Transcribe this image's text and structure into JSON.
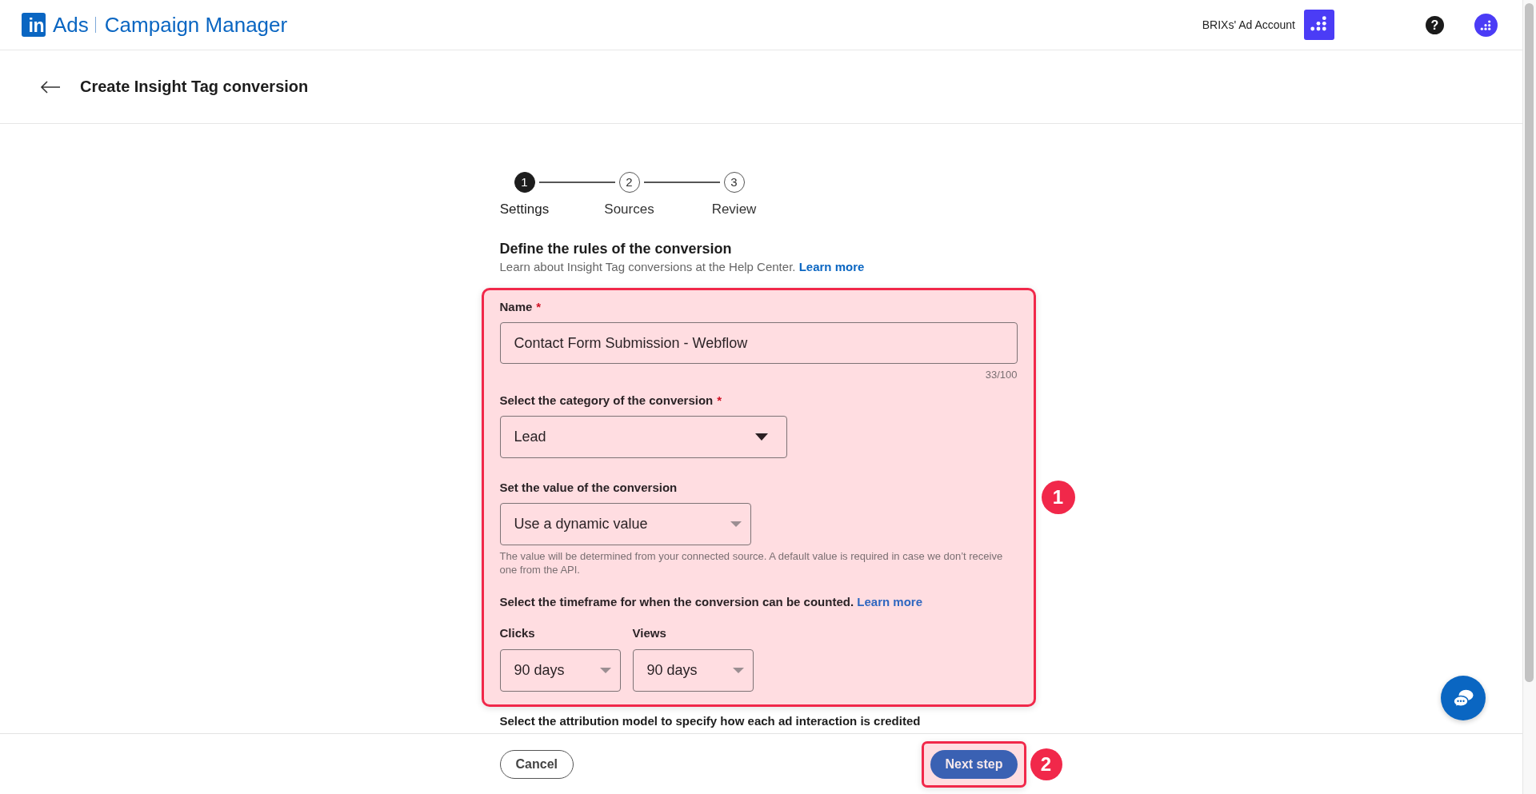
{
  "top_bar": {
    "logo": {
      "mark": "in",
      "product": "Ads",
      "app": "Campaign Manager"
    },
    "account": {
      "name": "BRIXs' Ad Account"
    },
    "help": "?"
  },
  "page_header": {
    "title": "Create Insight Tag conversion"
  },
  "stepper": {
    "steps": [
      {
        "number": "1",
        "label": "Settings",
        "selected": true
      },
      {
        "number": "2",
        "label": "Sources",
        "selected": false
      },
      {
        "number": "3",
        "label": "Review",
        "selected": false
      }
    ]
  },
  "section": {
    "title": "Define the rules of the conversion",
    "description": "Learn about Insight Tag conversions at the Help Center.",
    "link": "Learn more"
  },
  "form": {
    "annotation": {
      "number": "1"
    },
    "fields": [
      {
        "kind": "text",
        "label": "Name",
        "required_mark": "*",
        "value": "Contact Form Submission - Webflow",
        "counter": "33/100"
      },
      {
        "kind": "select",
        "label": "Select the category of the conversion",
        "required_mark": "*",
        "value": "Lead",
        "focused": true
      },
      {
        "kind": "select",
        "label": "Set the value of the conversion",
        "value": "Use a dynamic value",
        "focused": false,
        "help": "The value will be determined from your connected source. A default value is required in case we don’t receive one from the API."
      },
      {
        "kind": "select_group",
        "label": "Select the timeframe for when the conversion can be counted.",
        "link": "Learn more",
        "selects": [
          {
            "label": "Clicks",
            "value": "90 days",
            "focused": false
          },
          {
            "label": "Views",
            "value": "90 days",
            "focused": false
          }
        ]
      }
    ]
  },
  "next_section": {
    "label": "Select the attribution model to specify how each ad interaction is credited"
  },
  "footer": {
    "cancel": "Cancel",
    "next": {
      "label": "Next step",
      "annotation": {
        "number": "2"
      }
    }
  }
}
